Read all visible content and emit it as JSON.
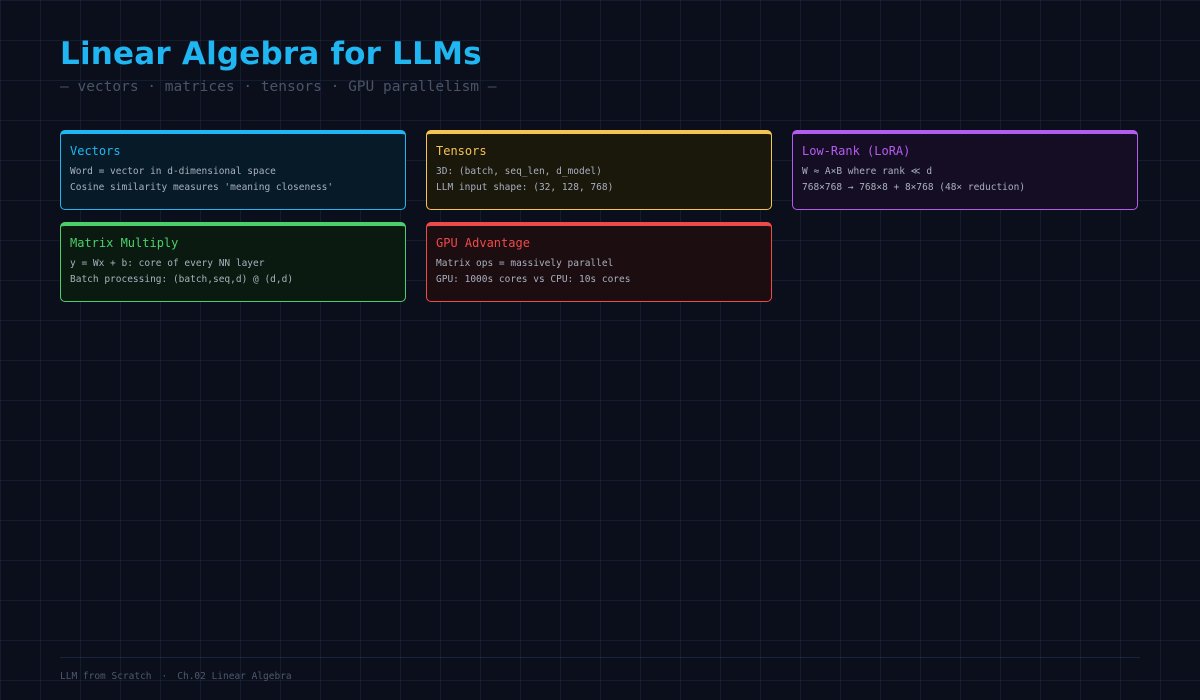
{
  "header": {
    "title": "Linear Algebra for LLMs",
    "subtitle": "— vectors · matrices · tensors · GPU parallelism —"
  },
  "cards": [
    {
      "id": "vectors",
      "title": "Vectors",
      "lines": [
        "Word = vector in d-dimensional space",
        "Cosine similarity measures 'meaning closeness'"
      ],
      "accent": "#1fb6f2",
      "background": "#071a28"
    },
    {
      "id": "tensors",
      "title": "Tensors",
      "lines": [
        "3D: (batch, seq_len, d_model)",
        "LLM input shape: (32, 128, 768)"
      ],
      "accent": "#f5c451",
      "background": "#1a170b"
    },
    {
      "id": "low-rank",
      "title": "Low-Rank (LoRA)",
      "lines": [
        "W ≈ A×B where rank ≪ d",
        "768×768 → 768×8 + 8×768 (48× reduction)"
      ],
      "accent": "#b45cf0",
      "background": "#150d24"
    },
    {
      "id": "matrix-multiply",
      "title": "Matrix Multiply",
      "lines": [
        "y = Wx + b: core of every NN layer",
        "Batch processing: (batch,seq,d) @ (d,d)"
      ],
      "accent": "#4ad06a",
      "background": "#0b1a10"
    },
    {
      "id": "gpu-advantage",
      "title": "GPU Advantage",
      "lines": [
        "Matrix ops = massively parallel",
        "GPU: 1000s cores vs CPU: 10s cores"
      ],
      "accent": "#ef4a4a",
      "background": "#1c0d10"
    }
  ],
  "footer": {
    "book": "LLM from Scratch",
    "separator": "·",
    "chapter": "Ch.02 Linear Algebra"
  }
}
